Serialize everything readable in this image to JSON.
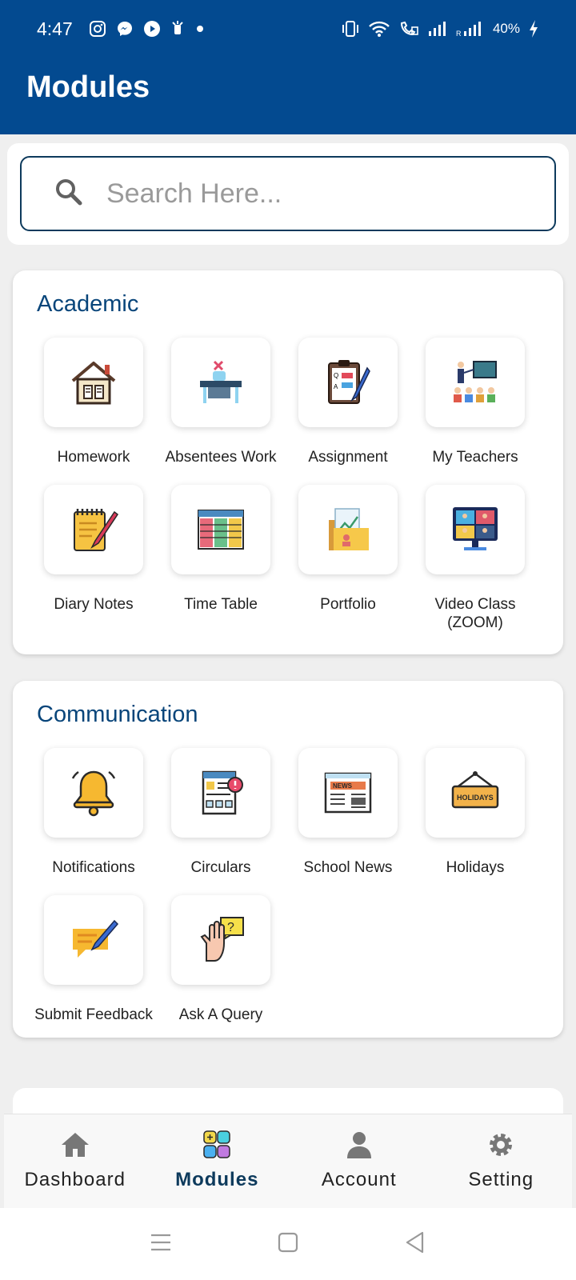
{
  "status_bar": {
    "time": "4:47",
    "battery": "40%",
    "left_icons": [
      "instagram-icon",
      "messenger-icon",
      "play-icon",
      "notification-icon",
      "dot-icon"
    ],
    "right_icons": [
      "vibrate-icon",
      "wifi-icon",
      "wifi-call-icon",
      "signal-icon",
      "signal-roaming-icon",
      "charging-icon"
    ]
  },
  "header": {
    "title": "Modules"
  },
  "search": {
    "placeholder": "Search Here..."
  },
  "sections": [
    {
      "title": "Academic",
      "items": [
        {
          "label": "Homework",
          "icon": "house-book-icon"
        },
        {
          "label": "Absentees Work",
          "icon": "empty-desk-icon"
        },
        {
          "label": "Assignment",
          "icon": "clipboard-pen-icon"
        },
        {
          "label": "My Teachers",
          "icon": "teacher-class-icon"
        },
        {
          "label": "Diary Notes",
          "icon": "notepad-pen-icon"
        },
        {
          "label": "Time Table",
          "icon": "timetable-icon"
        },
        {
          "label": "Portfolio",
          "icon": "portfolio-folder-icon"
        },
        {
          "label": "Video Class\n(ZOOM)",
          "icon": "video-call-icon"
        }
      ]
    },
    {
      "title": "Communication",
      "items": [
        {
          "label": "Notifications",
          "icon": "bell-icon"
        },
        {
          "label": "Circulars",
          "icon": "circular-doc-icon"
        },
        {
          "label": "School News",
          "icon": "newspaper-icon"
        },
        {
          "label": "Holidays",
          "icon": "holidays-sign-icon"
        },
        {
          "label": "Submit Feedback",
          "icon": "feedback-icon"
        },
        {
          "label": "Ask A Query",
          "icon": "hand-question-icon"
        }
      ]
    }
  ],
  "bottom_nav": [
    {
      "label": "Dashboard",
      "icon": "home-icon"
    },
    {
      "label": "Modules",
      "icon": "modules-grid-icon"
    },
    {
      "label": "Account",
      "icon": "person-icon"
    },
    {
      "label": "Setting",
      "icon": "gear-icon"
    }
  ],
  "colors": {
    "header": "#034a90",
    "accent": "#08457a",
    "active_nav": "#0d3a5c"
  }
}
